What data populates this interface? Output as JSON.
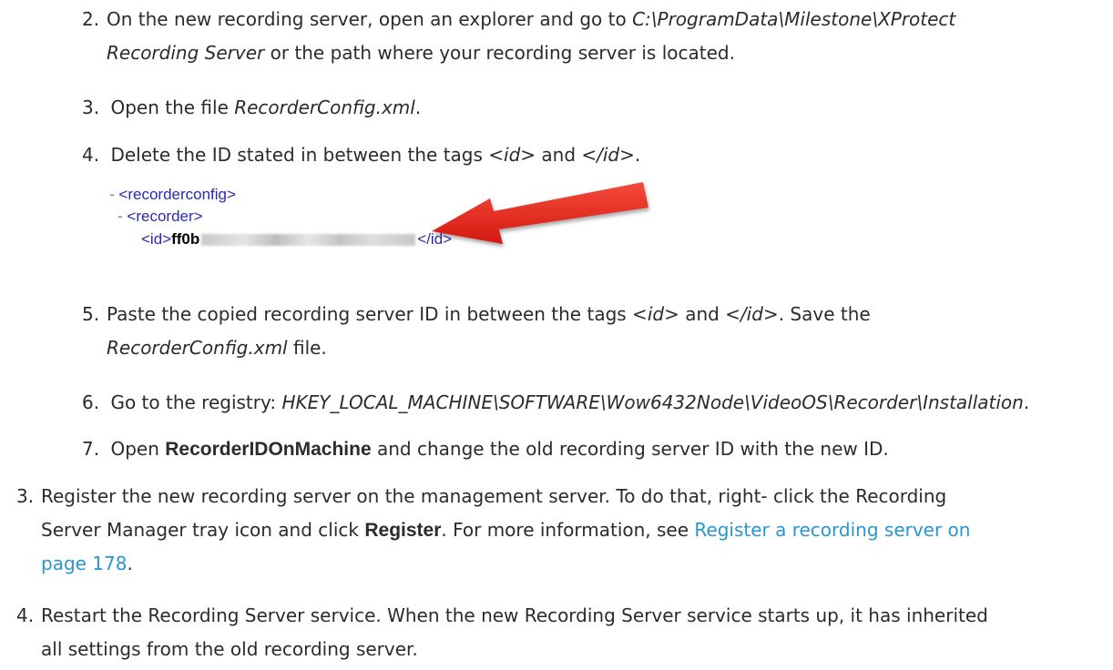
{
  "steps": {
    "s2": {
      "num": "2.",
      "line1_pre": "On the new recording server, open an explorer and go to ",
      "line1_path": "C:\\ProgramData\\Milestone\\XProtect",
      "line2_path": "Recording Server",
      "line2_post": " or the path where your recording server is located."
    },
    "s3": {
      "num": "3.",
      "pre": "Open the file ",
      "file": "RecorderConfig.xml",
      "post": "."
    },
    "s4": {
      "num": "4.",
      "pre": "Delete the ID stated in between the tags <",
      "tag1": "id",
      "mid": "> and <",
      "tag2": "/id",
      "post": ">."
    },
    "xml": {
      "dash1": "-",
      "line1": "<recorderconfig>",
      "dash2": "-",
      "line2": "<recorder>",
      "open": "<id>",
      "id_start": "ff0b",
      "close": "</id>"
    },
    "s5": {
      "num": "5.",
      "pre": "Paste the copied recording server ID in between the tags <",
      "tag1": "id",
      "mid": "> and <",
      "tag2": "/id",
      "post": ">. Save the",
      "file": "RecorderConfig.xml",
      "post2": " file."
    },
    "s6": {
      "num": "6.",
      "pre": "Go to the registry: ",
      "path": "HKEY_LOCAL_MACHINE\\SOFTWARE\\Wow6432Node\\VideoOS\\Recorder\\Installation",
      "post": "."
    },
    "s7": {
      "num": "7.",
      "pre": "Open ",
      "key": "RecorderIDOnMachine",
      "post": " and change the old recording server ID with the new ID."
    }
  },
  "main": {
    "m3": {
      "num": "3.",
      "line1": "Register the new recording server on the management server. To do that, right- click the Recording",
      "line2_pre": "Server Manager tray icon and click ",
      "line2_bold": "Register",
      "line2_mid": ". For more information, see ",
      "link_a": "Register a recording server on",
      "link_b": "page 178",
      "line3_post": "."
    },
    "m4": {
      "num": "4.",
      "line1": "Restart the Recording Server service. When the new Recording Server service starts up, it has inherited",
      "line2": "all settings from the old recording server."
    }
  },
  "colors": {
    "text": "#2b2b2b",
    "link": "#2a96cf",
    "arrow": "#e02020"
  }
}
